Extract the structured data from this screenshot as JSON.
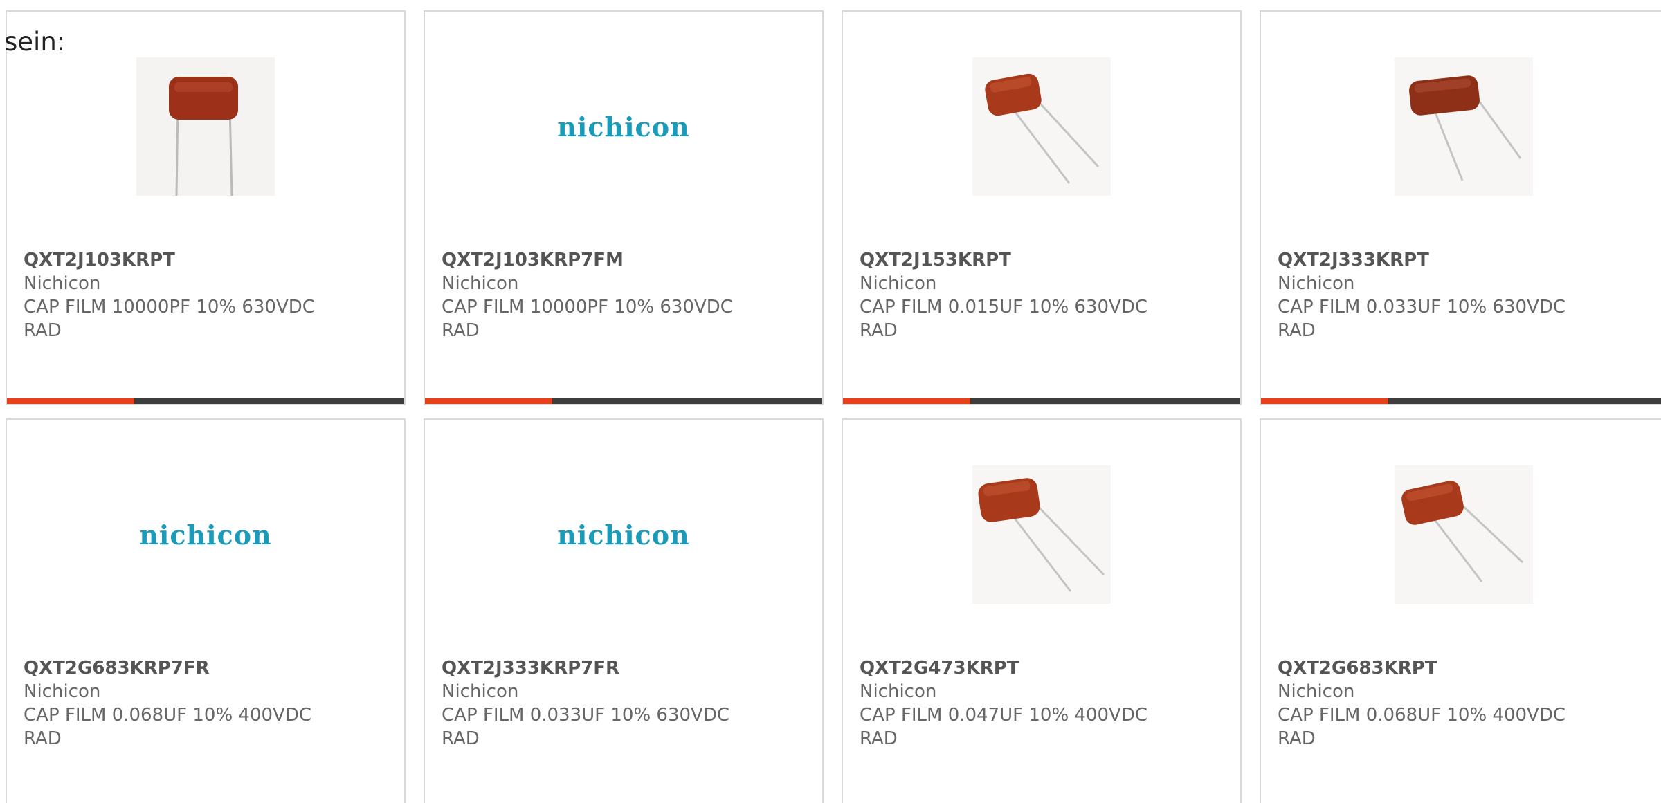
{
  "intro_text": "sein:",
  "colors": {
    "accent": "#e8401a",
    "bar": "#3d3d3d",
    "logo": "#1a9bb9",
    "capacitor_body": "#9c3018"
  },
  "cards": [
    {
      "part": "QXT2J103KRPT",
      "brand": "Nichicon",
      "desc": "CAP FILM 10000PF 10% 630VDC",
      "pkg": "RAD",
      "image": "capacitor-photo"
    },
    {
      "part": "QXT2J103KRP7FM",
      "brand": "Nichicon",
      "desc": "CAP FILM 10000PF 10% 630VDC",
      "pkg": "RAD",
      "image": "nichicon-logo",
      "logo_text": "nichicon"
    },
    {
      "part": "QXT2J153KRPT",
      "brand": "Nichicon",
      "desc": "CAP FILM 0.015UF 10% 630VDC",
      "pkg": "RAD",
      "image": "capacitor-photo"
    },
    {
      "part": "QXT2J333KRPT",
      "brand": "Nichicon",
      "desc": "CAP FILM 0.033UF 10% 630VDC",
      "pkg": "RAD",
      "image": "capacitor-photo"
    },
    {
      "part": "QXT2G683KRP7FR",
      "brand": "Nichicon",
      "desc": "CAP FILM 0.068UF 10% 400VDC",
      "pkg": "RAD",
      "image": "nichicon-logo",
      "logo_text": "nichicon"
    },
    {
      "part": "QXT2J333KRP7FR",
      "brand": "Nichicon",
      "desc": "CAP FILM 0.033UF 10% 630VDC",
      "pkg": "RAD",
      "image": "nichicon-logo",
      "logo_text": "nichicon"
    },
    {
      "part": "QXT2G473KRPT",
      "brand": "Nichicon",
      "desc": "CAP FILM 0.047UF 10% 400VDC",
      "pkg": "RAD",
      "image": "capacitor-photo"
    },
    {
      "part": "QXT2G683KRPT",
      "brand": "Nichicon",
      "desc": "CAP FILM 0.068UF 10% 400VDC",
      "pkg": "RAD",
      "image": "capacitor-photo"
    }
  ]
}
